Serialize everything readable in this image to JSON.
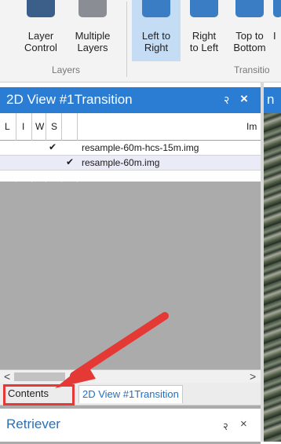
{
  "ribbon": {
    "buttons": [
      {
        "line1": "Layer",
        "line2": "Control",
        "icon": "layer-control-icon"
      },
      {
        "line1": "Multiple",
        "line2": "Layers",
        "icon": "multiple-layers-icon"
      },
      {
        "line1": "Left to",
        "line2": "Right",
        "icon": "left-to-right-icon"
      },
      {
        "line1": "Right",
        "line2": "to Left",
        "icon": "right-to-left-icon"
      },
      {
        "line1": "Top to",
        "line2": "Bottom",
        "icon": "top-to-bottom-icon"
      },
      {
        "line1": "I",
        "line2": "",
        "icon": "transition-icon"
      }
    ],
    "groups": {
      "layers": "Layers",
      "transitions": "Transitio"
    }
  },
  "panel": {
    "title": "2D View #1Transition",
    "pin_glyph": "२",
    "close_glyph": "×",
    "columns": [
      "L",
      "I",
      "W",
      "S",
      "Im"
    ],
    "rows": [
      {
        "w_checked": "✔",
        "s_checked": "",
        "name": "resample-60m-hcs-15m.img"
      },
      {
        "w_checked": "",
        "s_checked": "✔",
        "name": "resample-60m.img"
      }
    ]
  },
  "scroll": {
    "left_arrow": "<",
    "right_arrow": ">"
  },
  "tabs": [
    "Contents",
    "2D View #1Transition"
  ],
  "retriever": {
    "title": "Retriever",
    "pin_glyph": "२",
    "close_glyph": "×"
  },
  "right_panel": {
    "title_fragment": "n"
  },
  "colors": {
    "accent": "#2b7cd3",
    "annotation": "#e53935",
    "selected_ribbon": "#c5dcf5"
  }
}
